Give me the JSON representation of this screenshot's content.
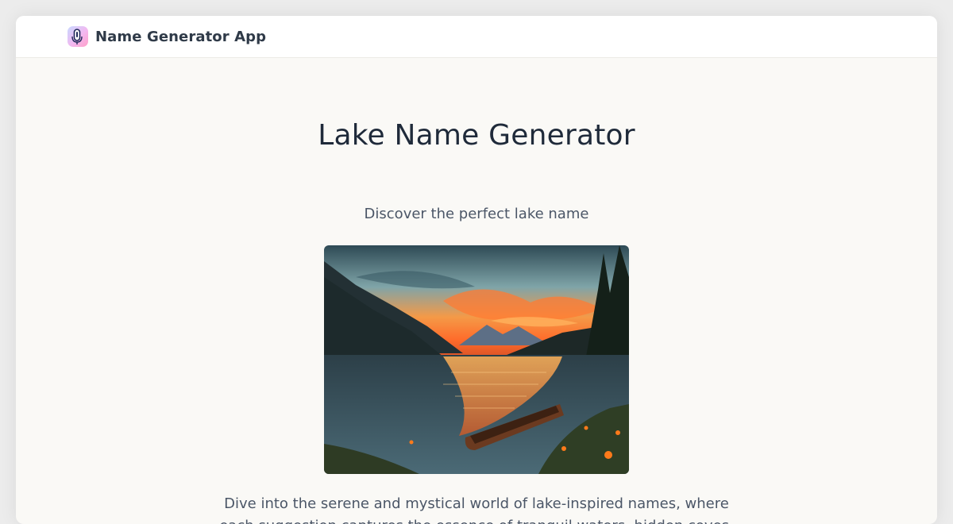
{
  "header": {
    "app_name": "Name Generator App",
    "logo_icon": "microphone-icon"
  },
  "main": {
    "title": "Lake Name Generator",
    "subtitle": "Discover the perfect lake name",
    "description": "Dive into the serene and mystical world of lake-inspired names, where each suggestion captures the essence of tranquil waters, hidden coves,"
  },
  "colors": {
    "frame_bg": "#faf9f6",
    "header_bg": "#ffffff",
    "brand_text": "#2f3a48",
    "title_text": "#1f2a3a",
    "body_text": "#4b5667"
  }
}
